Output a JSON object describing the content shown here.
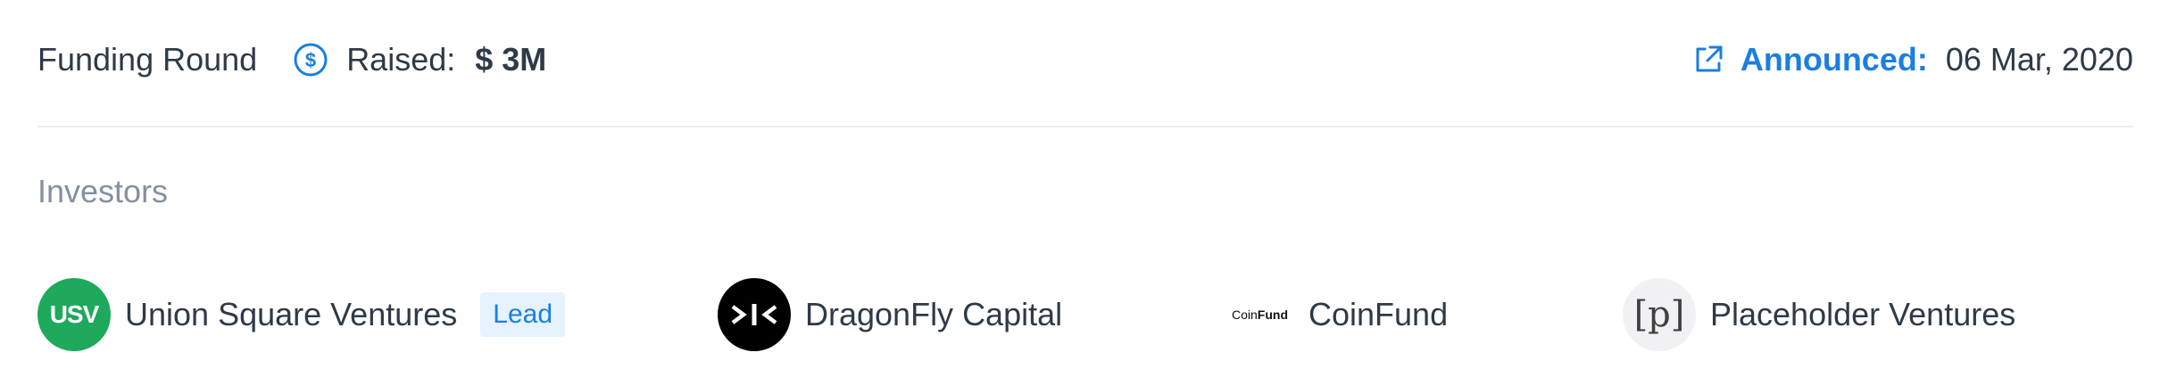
{
  "header": {
    "title": "Funding Round",
    "raised_label": "Raised:",
    "raised_value": "$ 3M",
    "announced_label": "Announced:",
    "announced_date": "06 Mar, 2020"
  },
  "investors": {
    "heading": "Investors",
    "items": [
      {
        "name": "Union Square Ventures",
        "logo_text": "USV",
        "badge": "Lead",
        "logo_color": "#1ea95c"
      },
      {
        "name": "DragonFly Capital",
        "logo_text": ">|<",
        "logo_color": "#000000"
      },
      {
        "name": "CoinFund",
        "logo_text_light": "Coin",
        "logo_text_bold": "Fund"
      },
      {
        "name": "Placeholder Ventures",
        "logo_text": "[p]",
        "logo_color": "#f1f1f3"
      }
    ]
  },
  "colors": {
    "accent": "#1a7fe0",
    "text": "#2e3a47",
    "muted": "#8390a0",
    "divider": "#ecedf0"
  },
  "icons": {
    "raised": "dollar-circle-icon",
    "announced": "external-link-icon"
  }
}
